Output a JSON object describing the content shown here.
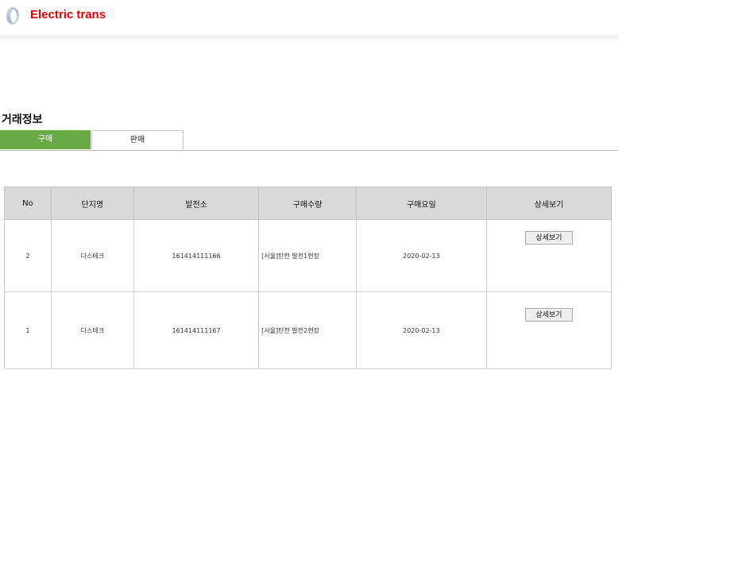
{
  "header": {
    "brand": "Electric trans",
    "logo_icon": "ring-logo-icon"
  },
  "section": {
    "title": "거래정보"
  },
  "tabs": [
    {
      "label": "구매",
      "active": true
    },
    {
      "label": "판매",
      "active": false
    }
  ],
  "table": {
    "headers": [
      "No",
      "단지명",
      "발전소",
      "구매수량",
      "구매요일",
      "상세보기"
    ],
    "rows": [
      {
        "no": "2",
        "site": "다스테크",
        "plant": "161414111166",
        "qty": "[서울]탄천 발전1현장",
        "date": "2020-02-13",
        "detail_label": "상세보기"
      },
      {
        "no": "1",
        "site": "다스테크",
        "plant": "161414111167",
        "qty": "[서울]탄천 발전2현장",
        "date": "2020-02-13",
        "detail_label": "상세보기"
      }
    ]
  },
  "colors": {
    "brand": "#e00000",
    "tab_active": "#6aaa46",
    "table_header_bg": "#d9d9d9"
  }
}
